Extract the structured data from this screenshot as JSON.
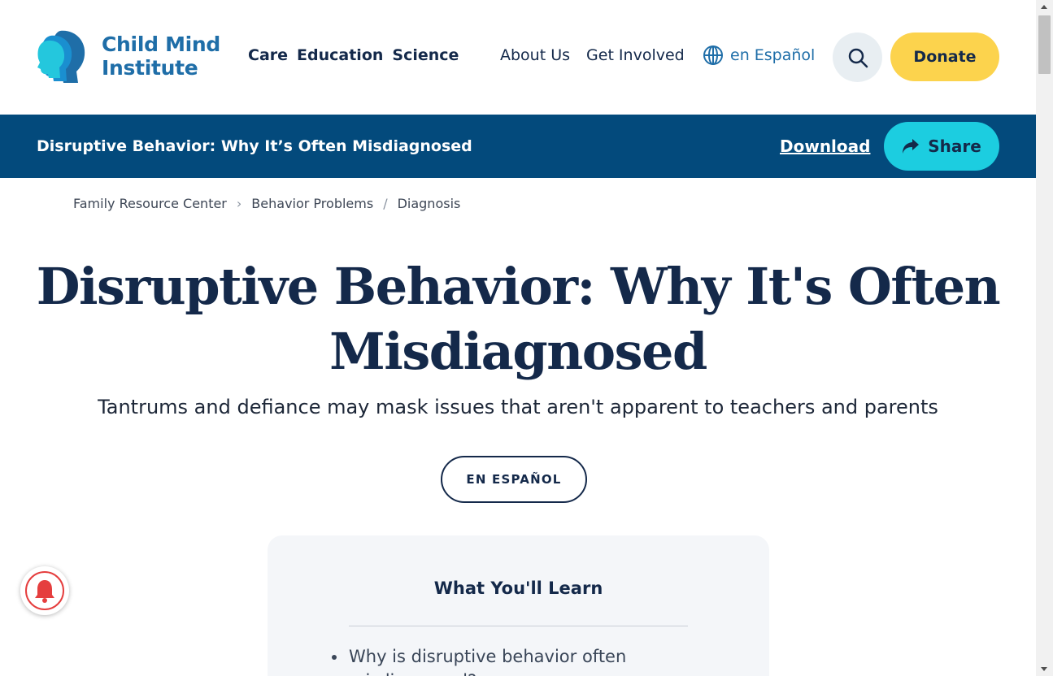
{
  "header": {
    "logo": {
      "line1": "Child Mind",
      "line2": "Institute"
    },
    "primary_nav": [
      "Care",
      "Education",
      "Science"
    ],
    "secondary_nav": [
      "About Us",
      "Get Involved"
    ],
    "language_link": "en Español",
    "search_icon": "search-icon",
    "donate_label": "Donate"
  },
  "article_bar": {
    "title": "Disruptive Behavior: Why It’s Often Misdiagnosed",
    "download_label": "Download",
    "share_label": "Share",
    "share_icon": "share-arrow-icon"
  },
  "breadcrumb": [
    "Family Resource Center",
    "Behavior Problems",
    "Diagnosis"
  ],
  "article": {
    "title_line1": "Disruptive Behavior: Why It's Often",
    "title_line2": "Misdiagnosed",
    "subtitle": "Tantrums and defiance may mask issues that aren't apparent to teachers and parents",
    "espanol_button": "EN ESPAÑOL"
  },
  "learn": {
    "heading": "What You'll Learn",
    "items": [
      "Why is disruptive behavior often misdiagnosed?"
    ]
  },
  "notification_icon": "bell-icon",
  "colors": {
    "brand_blue": "#1f6ea8",
    "brand_navy": "#14294a",
    "bar_blue": "#034a7c",
    "donate_yellow": "#fcd34d",
    "share_cyan": "#1ccde0",
    "bell_red": "#e53e3e"
  }
}
